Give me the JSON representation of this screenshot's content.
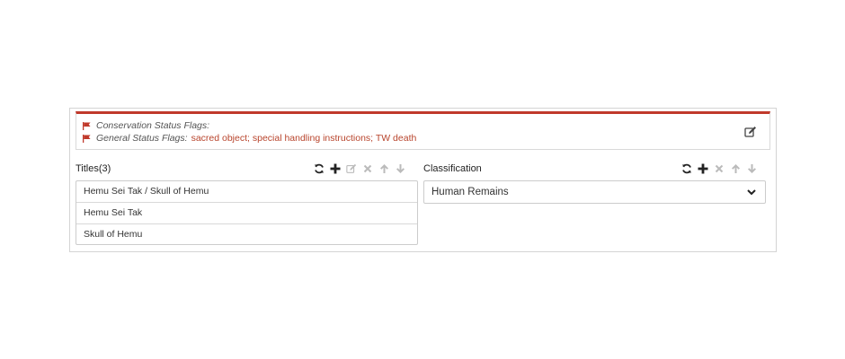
{
  "flags": {
    "conservation_label": "Conservation Status Flags:",
    "conservation_value": "",
    "general_label": "General Status Flags:",
    "general_value": "sacred object; special handling instructions; TW death"
  },
  "titles": {
    "heading": "Titles",
    "count": "(3)",
    "items": [
      "Hemu Sei Tak /  Skull of Hemu",
      "Hemu Sei Tak",
      "Skull of Hemu"
    ]
  },
  "classification": {
    "heading": "Classification",
    "selected": "Human Remains"
  },
  "colors": {
    "accent": "#c0392b",
    "flag_value": "#b8442c",
    "icon_active": "#222222",
    "icon_disabled": "#bbbbbb"
  },
  "icons": {
    "flag": "flag-icon",
    "edit": "edit-icon",
    "refresh": "refresh-icon",
    "add": "plus-icon",
    "remove": "close-icon",
    "move_up": "arrow-up-icon",
    "move_down": "arrow-down-icon",
    "dropdown": "chevron-down-icon"
  }
}
